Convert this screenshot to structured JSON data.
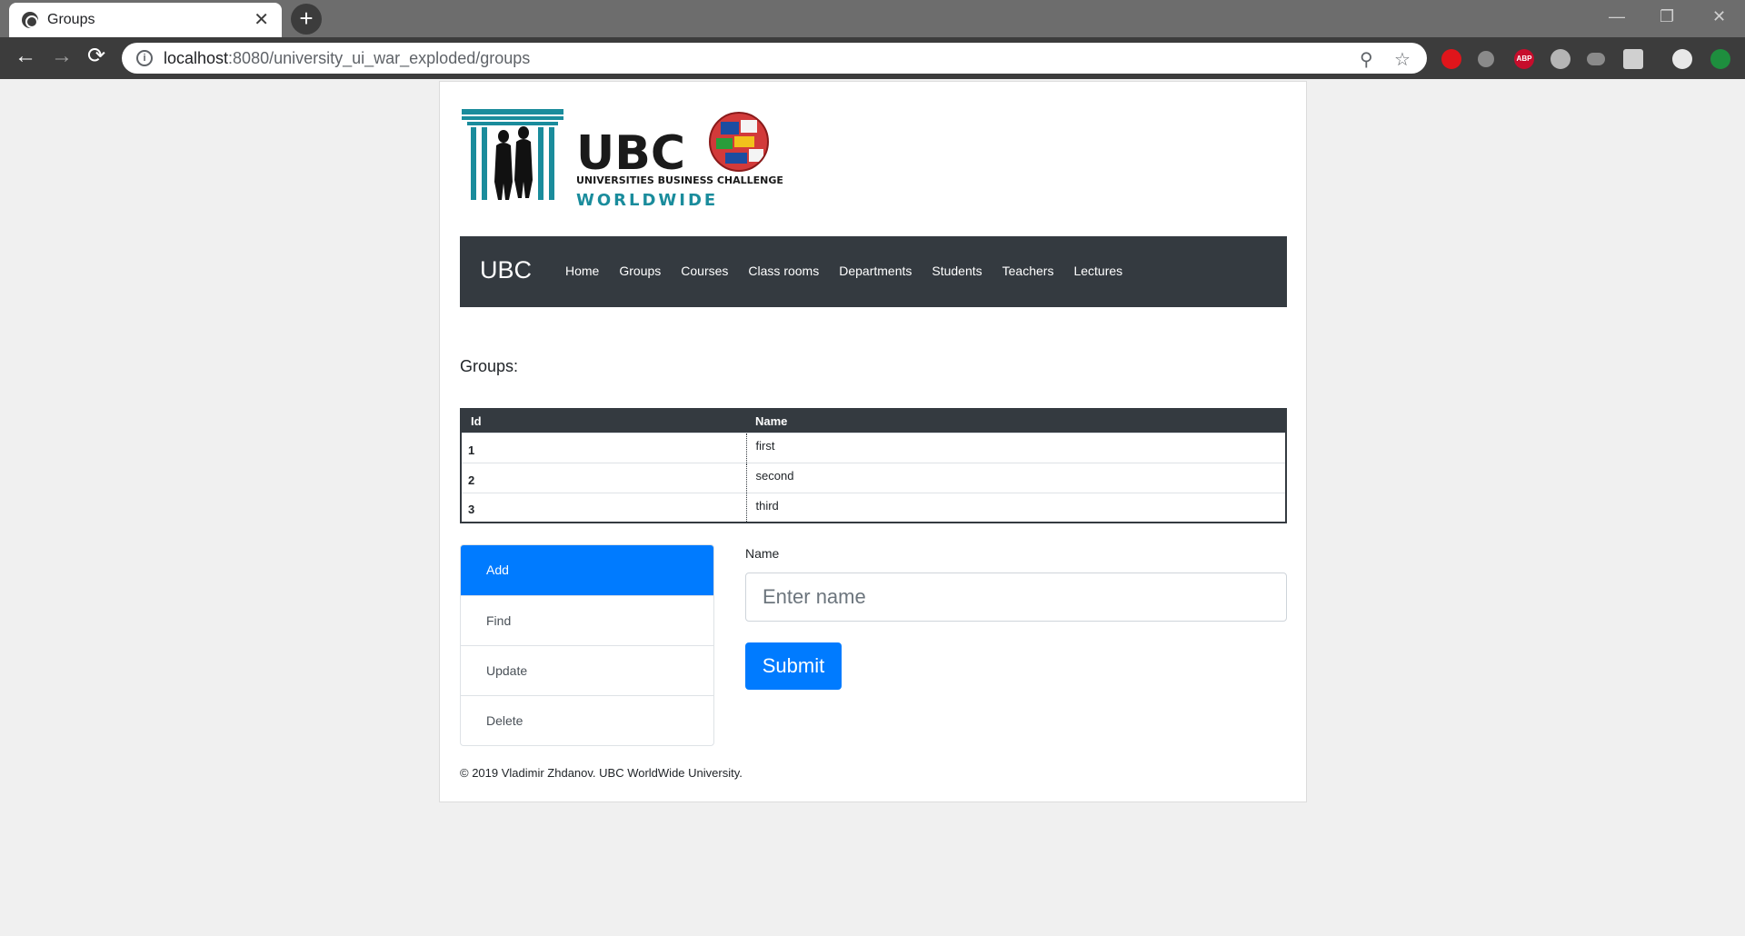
{
  "browser": {
    "tab_title": "Groups",
    "tab_close": "✕",
    "new_tab": "+",
    "url_host": "localhost",
    "url_rest": ":8080/university_ui_war_exploded/groups",
    "back_glyph": "←",
    "forward_glyph": "→",
    "reload_glyph": "⟳",
    "zoom_glyph": "⚲",
    "star_glyph": "☆",
    "minimize_glyph": "—",
    "restore_glyph": "❐",
    "close_glyph": "✕",
    "abp_label": "ABP"
  },
  "logo": {
    "name": "UBC",
    "subtitle": "UNIVERSITIES BUSINESS CHALLENGE",
    "tagline": "WORLDWIDE"
  },
  "navbar": {
    "brand": "UBC",
    "items": [
      "Home",
      "Groups",
      "Courses",
      "Class rooms",
      "Departments",
      "Students",
      "Teachers",
      "Lectures"
    ]
  },
  "page": {
    "heading": "Groups:"
  },
  "table": {
    "headers": [
      "Id",
      "Name"
    ],
    "rows": [
      {
        "id": "1",
        "name": "first"
      },
      {
        "id": "2",
        "name": "second"
      },
      {
        "id": "3",
        "name": "third"
      }
    ]
  },
  "actions": {
    "items": [
      "Add",
      "Find",
      "Update",
      "Delete"
    ],
    "active": "Add"
  },
  "form": {
    "label": "Name",
    "placeholder": "Enter name",
    "submit": "Submit"
  },
  "footer": {
    "text": "© 2019 Vladimir Zhdanov. UBC WorldWide University."
  },
  "colors": {
    "primary": "#007bff",
    "navbar": "#343a40",
    "logo_teal": "#1a8c9c"
  }
}
